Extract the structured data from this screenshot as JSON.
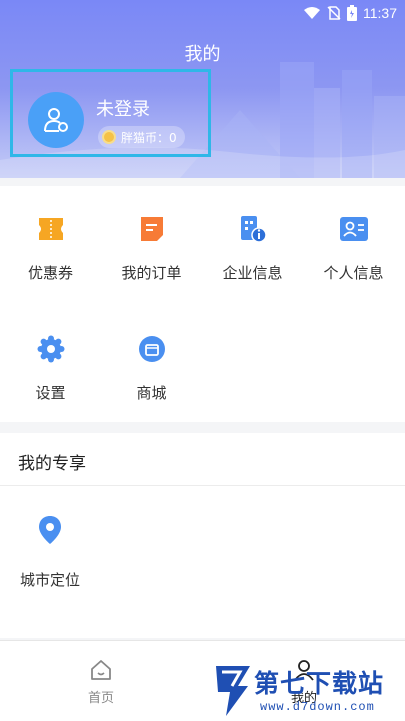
{
  "status_bar": {
    "time": "11:37"
  },
  "header": {
    "title": "我的",
    "login_text": "未登录",
    "coins_label": "胖猫币：0"
  },
  "menu_items": [
    {
      "label": "优惠券",
      "icon": "coupon-icon"
    },
    {
      "label": "我的订单",
      "icon": "order-icon"
    },
    {
      "label": "企业信息",
      "icon": "company-info-icon"
    },
    {
      "label": "个人信息",
      "icon": "personal-info-icon"
    },
    {
      "label": "设置",
      "icon": "gear-icon"
    },
    {
      "label": "商城",
      "icon": "store-icon"
    }
  ],
  "exclusive": {
    "title": "我的专享",
    "items": [
      {
        "label": "城市定位",
        "icon": "location-pin-icon"
      }
    ]
  },
  "bottom_nav": [
    {
      "label": "首页",
      "icon": "home-icon",
      "active": false
    },
    {
      "label": "我的",
      "icon": "user-icon",
      "active": true
    }
  ],
  "watermark": {
    "text": "第七下载站",
    "url": "www.d7down.com"
  },
  "colors": {
    "header_gradient_top": "#7a88f6",
    "accent_blue": "#4a8ff0",
    "coupon_orange": "#f6a623",
    "order_orange": "#f77b36",
    "highlight_box": "#2fb7e8"
  }
}
